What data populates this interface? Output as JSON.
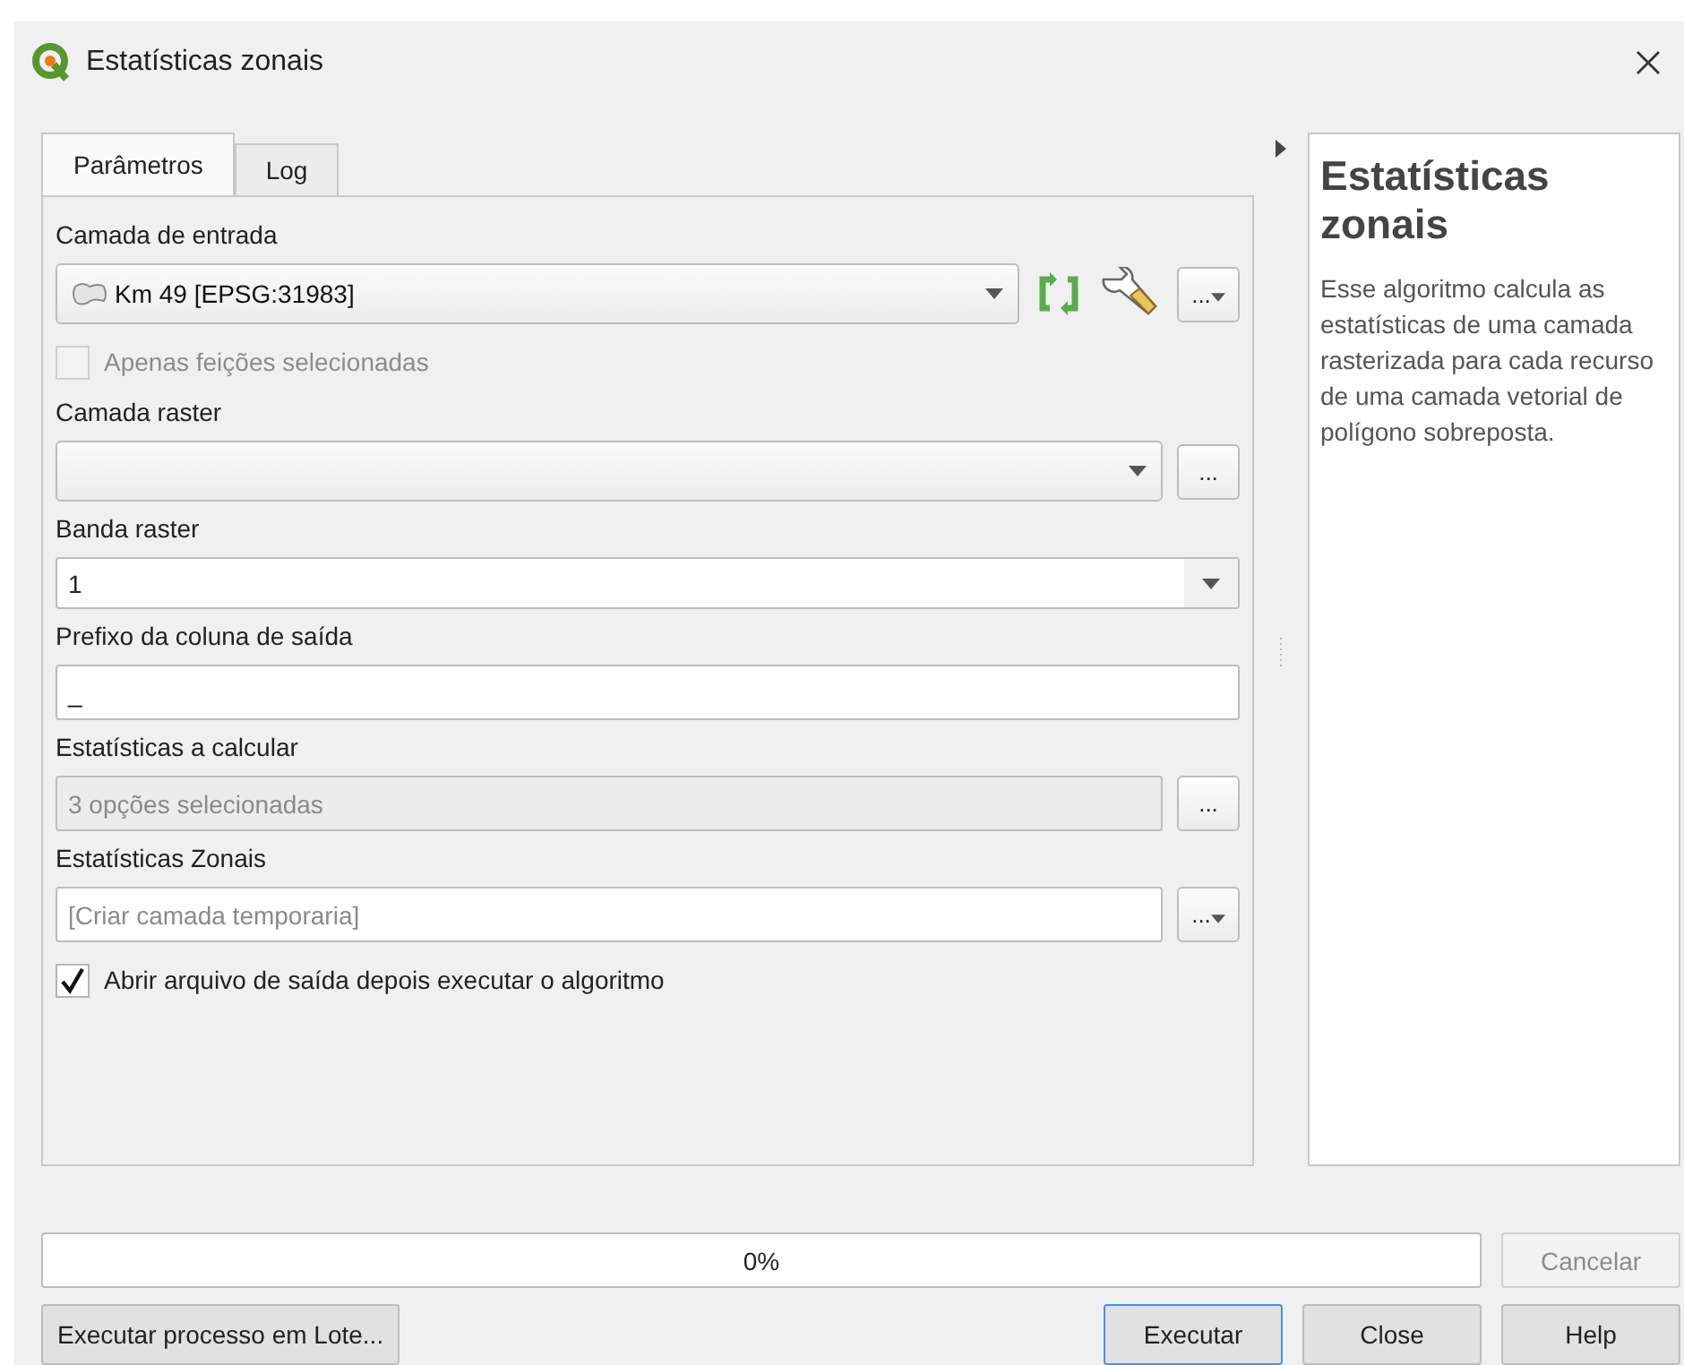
{
  "window": {
    "title": "Estatísticas zonais"
  },
  "tabs": [
    {
      "label": "Parâmetros",
      "selected": true
    },
    {
      "label": "Log",
      "selected": false
    }
  ],
  "parameters": [
    {
      "kind": "layer",
      "label": "Camada de entrada",
      "value": "Km 49 [EPSG:31983]",
      "button": "...",
      "button_menu": true
    },
    {
      "kind": "checkbox",
      "label": "Apenas feições selecionadas",
      "checked": false,
      "disabled": true
    },
    {
      "kind": "combo",
      "label": "Camada raster",
      "button": "...",
      "button_menu": false
    },
    {
      "kind": "select",
      "label": "Banda raster",
      "value": "1"
    },
    {
      "kind": "text",
      "label": "Prefixo da coluna de saída",
      "value": "_"
    },
    {
      "kind": "multi",
      "label": "Estatísticas a calcular",
      "value": "3 opções selecionadas",
      "button": "...",
      "button_menu": false
    },
    {
      "kind": "output",
      "label": "Estatísticas Zonais",
      "placeholder": "[Criar camada temporaria]",
      "button": "...",
      "button_menu": true
    },
    {
      "kind": "checkbox",
      "label": "Abrir arquivo de saída depois executar o algoritmo",
      "checked": true,
      "disabled": false
    }
  ],
  "help": {
    "title": "Estatísticas zonais",
    "text": "Esse algoritmo calcula as estatísticas de uma camada rasterizada para cada recurso de uma camada vetorial de polígono sobreposta."
  },
  "progress": {
    "level": 0,
    "text": "0%"
  },
  "cancel_button": {
    "label": "Cancelar",
    "disabled": true
  },
  "buttons": [
    {
      "label": "Executar processo em Lote...",
      "default": false
    },
    {
      "label": "Executar",
      "default": true
    },
    {
      "label": "Close",
      "default": false
    },
    {
      "label": "Help",
      "default": false
    }
  ]
}
